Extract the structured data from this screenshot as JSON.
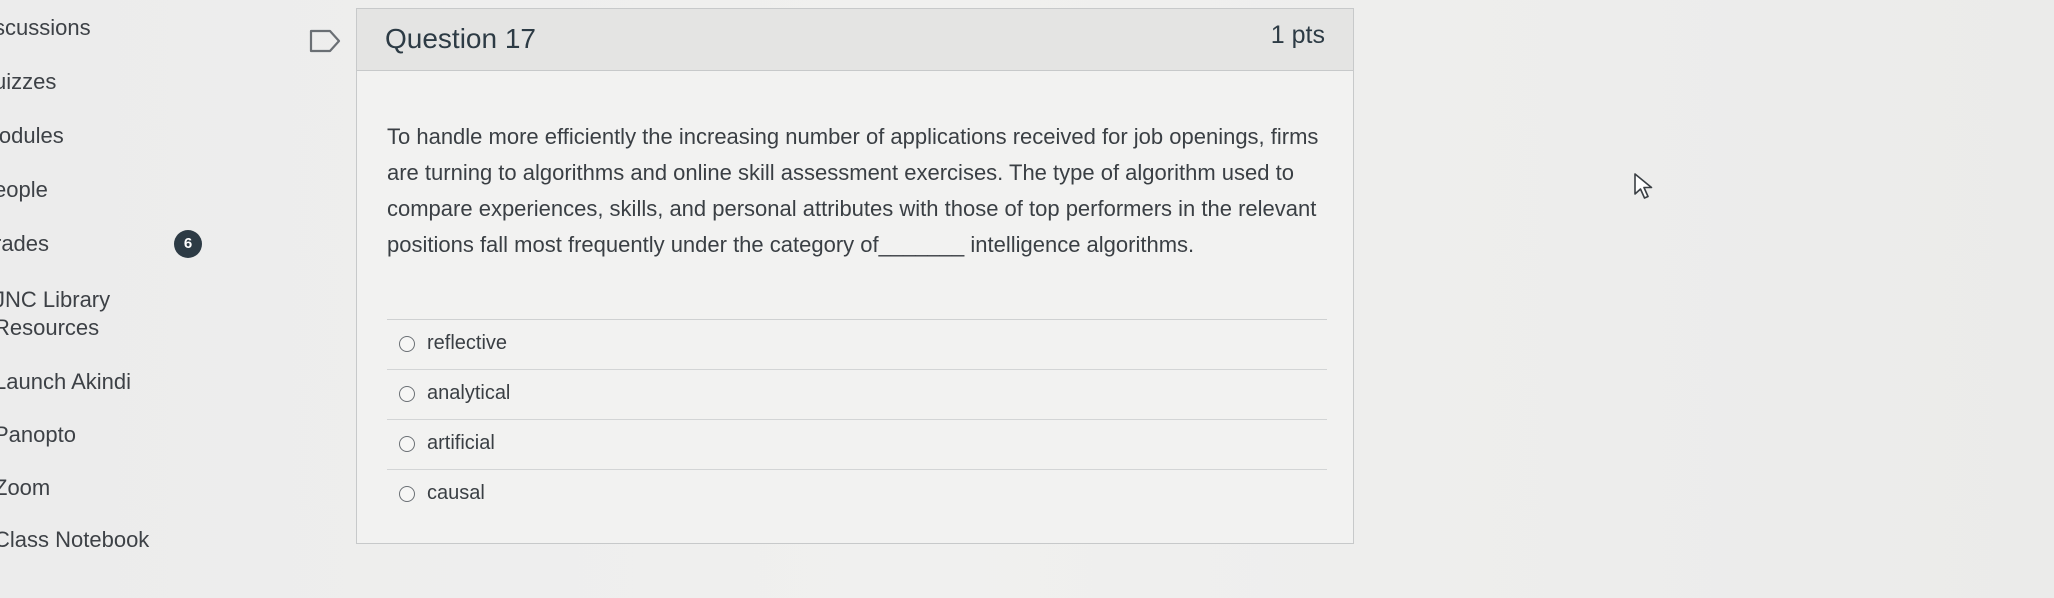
{
  "course_nav": {
    "items": [
      {
        "label": "scussions"
      },
      {
        "label": "uizzes"
      },
      {
        "label": "lodules"
      },
      {
        "label": "eople"
      },
      {
        "label": "rades",
        "badge": "6"
      },
      {
        "label": "JNC Library"
      },
      {
        "label": "Resources"
      },
      {
        "label": "Launch Akindi"
      },
      {
        "label": "Panopto"
      },
      {
        "label": "Zoom"
      },
      {
        "label": "Class Notebook"
      }
    ]
  },
  "question": {
    "title": "Question 17",
    "points": "1 pts",
    "text": "To handle more efficiently the increasing number of applications received for job openings, firms are turning to algorithms and online skill assessment exercises. The type of algorithm used to compare experiences, skills, and personal attributes with those of top performers in the relevant positions fall most frequently under the category of_______ intelligence algorithms.",
    "answers": [
      {
        "label": "reflective"
      },
      {
        "label": "analytical"
      },
      {
        "label": "artificial"
      },
      {
        "label": "causal"
      }
    ]
  },
  "icons": {
    "flag": "flag-icon",
    "cursor": "mouse-pointer-icon"
  }
}
